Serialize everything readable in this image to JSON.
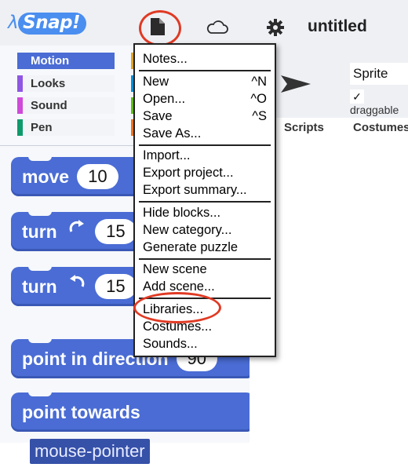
{
  "app": {
    "logo_text": "Snap!",
    "project_title": "untitled"
  },
  "toolbar": {
    "icons": [
      "file-icon",
      "cloud-icon",
      "gear-icon"
    ]
  },
  "categories": [
    {
      "label": "Motion",
      "color": "#4a6cd4",
      "active": true
    },
    {
      "label": "Looks",
      "color": "#8f56e3"
    },
    {
      "label": "Sound",
      "color": "#cf4ad9"
    },
    {
      "label": "Pen",
      "color": "#0e9a6c"
    }
  ],
  "blocks": {
    "move": {
      "label": "move",
      "value": "10"
    },
    "turn_cw": {
      "label": "turn",
      "value": "15"
    },
    "turn_ccw": {
      "label": "turn",
      "value": "15"
    },
    "point_direction": {
      "label": "point in direction",
      "value": "90"
    },
    "point_towards": {
      "label": "point towards",
      "value": "mouse-pointer"
    }
  },
  "sprite": {
    "name": "Sprite",
    "draggable_label": "draggable",
    "check": "✓"
  },
  "tabs": {
    "scripts": "Scripts",
    "costumes": "Costumes"
  },
  "file_menu": {
    "items": [
      {
        "label": "Notes..."
      },
      {
        "label": "New",
        "shortcut": "^N"
      },
      {
        "label": "Open...",
        "shortcut": "^O"
      },
      {
        "label": "Save",
        "shortcut": "^S"
      },
      {
        "label": "Save As..."
      },
      {
        "label": "Import..."
      },
      {
        "label": "Export project..."
      },
      {
        "label": "Export summary..."
      },
      {
        "label": "Hide blocks..."
      },
      {
        "label": "New category..."
      },
      {
        "label": "Generate puzzle"
      },
      {
        "label": "New scene"
      },
      {
        "label": "Add scene..."
      },
      {
        "label": "Libraries..."
      },
      {
        "label": "Costumes..."
      },
      {
        "label": "Sounds..."
      }
    ]
  },
  "colors": {
    "accent": "#4a6cd4",
    "highlight": "#e03a24"
  }
}
